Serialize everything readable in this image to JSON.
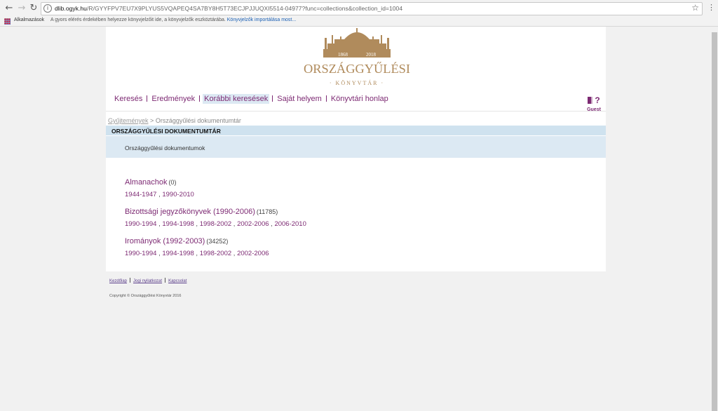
{
  "browser": {
    "url_host": "dlib.ogyk.hu",
    "url_path": "/R/GYYFPV7EU7X9PLYUS5VQAPEQ4SA7BY8H5T73ECJPJJUQXI5514-04977?func=collections&collection_id=1004",
    "bookmarks_apps": "Alkalmazások",
    "bookmarks_info": "A gyors elérés érdekében helyezze könyvjelzőit ide, a könyvjelzők eszköztárába.",
    "bookmarks_import": "Könyvjelzők importálása most..."
  },
  "logo": {
    "year_left": "1868",
    "year_right": "2018",
    "name": "ORSZÁGGYŰLÉSI",
    "sub": "· KÖNYVTÁR ·",
    "color": "#b08b5c"
  },
  "menu": {
    "items": [
      "Keresés",
      "Eredmények",
      "Korábbi keresések",
      "Saját helyem",
      "Könyvtári honlap"
    ],
    "guest": "Guest"
  },
  "breadcrumb": {
    "link": "Gyűjtemények",
    "separator": ">",
    "current": "Országgyűlési dokumentumtár"
  },
  "collection": {
    "title": "ORSZÁGGYŰLÉSI DOKUMENTUMTÁR",
    "description": "Országgyűlési dokumentumok"
  },
  "groups": [
    {
      "title": "Almanachok",
      "count": "(0)",
      "subs": [
        "1944-1947",
        "1990-2010"
      ]
    },
    {
      "title": "Bizottsági jegyzőkönyvek (1990-2006)",
      "count": "(11785)",
      "subs": [
        "1990-1994",
        "1994-1998",
        "1998-2002",
        "2002-2006",
        "2006-2010"
      ]
    },
    {
      "title": "Irományok (1992-2003)",
      "count": "(34252)",
      "subs": [
        "1990-1994",
        "1994-1998",
        "1998-2002",
        "2002-2006"
      ]
    }
  ],
  "footer": {
    "links": [
      "Kezdőlap",
      "Jogi nyilatkozat",
      "Kapcsolat"
    ],
    "copyright": "Copyright © Országgyűlési Könyvtár 2016"
  },
  "colors": {
    "accent": "#7d2a73",
    "header_bg": "#cfe2ef",
    "desc_bg": "#dce9f3"
  }
}
